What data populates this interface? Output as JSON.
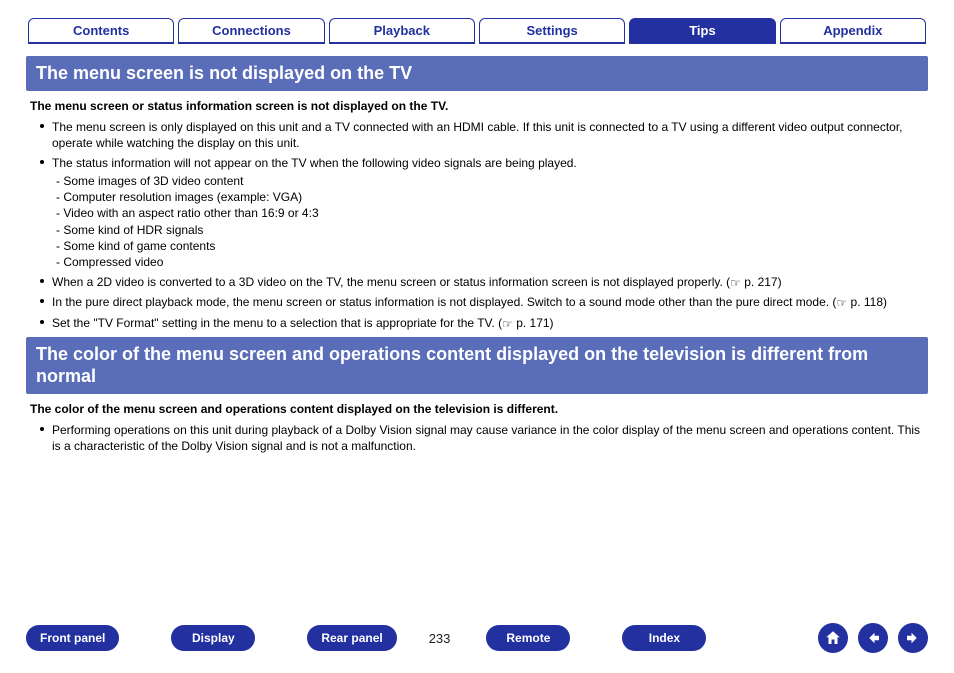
{
  "tabs": {
    "contents": "Contents",
    "connections": "Connections",
    "playback": "Playback",
    "settings": "Settings",
    "tips": "Tips",
    "appendix": "Appendix"
  },
  "section1": {
    "title": "The menu screen is not displayed on the TV",
    "intro": "The menu screen or status information screen is not displayed on the TV.",
    "b1": "The menu screen is only displayed on this unit and a TV connected with an HDMI cable. If this unit is connected to a TV using a different video output connector, operate while watching the display on this unit.",
    "b2": "The status information will not appear on the TV when the following video signals are being played.",
    "b2_s1": "- Some images of 3D video content",
    "b2_s2": "- Computer resolution images (example: VGA)",
    "b2_s3": "- Video with an aspect ratio other than 16:9 or 4:3",
    "b2_s4": "- Some kind of HDR signals",
    "b2_s5": "- Some kind of game contents",
    "b2_s6": "- Compressed video",
    "b3_a": "When a 2D video is converted to a 3D video on the TV, the menu screen or status information screen is not displayed properly.  (",
    "b3_b": " p. 217)",
    "b4_a": "In the pure direct playback mode, the menu screen or status information is not displayed. Switch to a sound mode other than the pure direct mode.  (",
    "b4_b": " p. 118)",
    "b5_a": "Set the \"TV Format\" setting in the menu to a selection that is appropriate for the TV.  (",
    "b5_b": " p. 171)"
  },
  "section2": {
    "title": "The color of the menu screen and operations content displayed on the television is different from normal",
    "intro": "The color of the menu screen and operations content displayed on the television is different.",
    "b1": "Performing operations on this unit during playback of a Dolby Vision signal may cause variance in the color display of the menu screen and operations content. This is a characteristic of the Dolby Vision signal and is not a malfunction."
  },
  "footer": {
    "front_panel": "Front panel",
    "display": "Display",
    "rear_panel": "Rear panel",
    "page": "233",
    "remote": "Remote",
    "index": "Index"
  },
  "icons": {
    "hand": "☞"
  }
}
